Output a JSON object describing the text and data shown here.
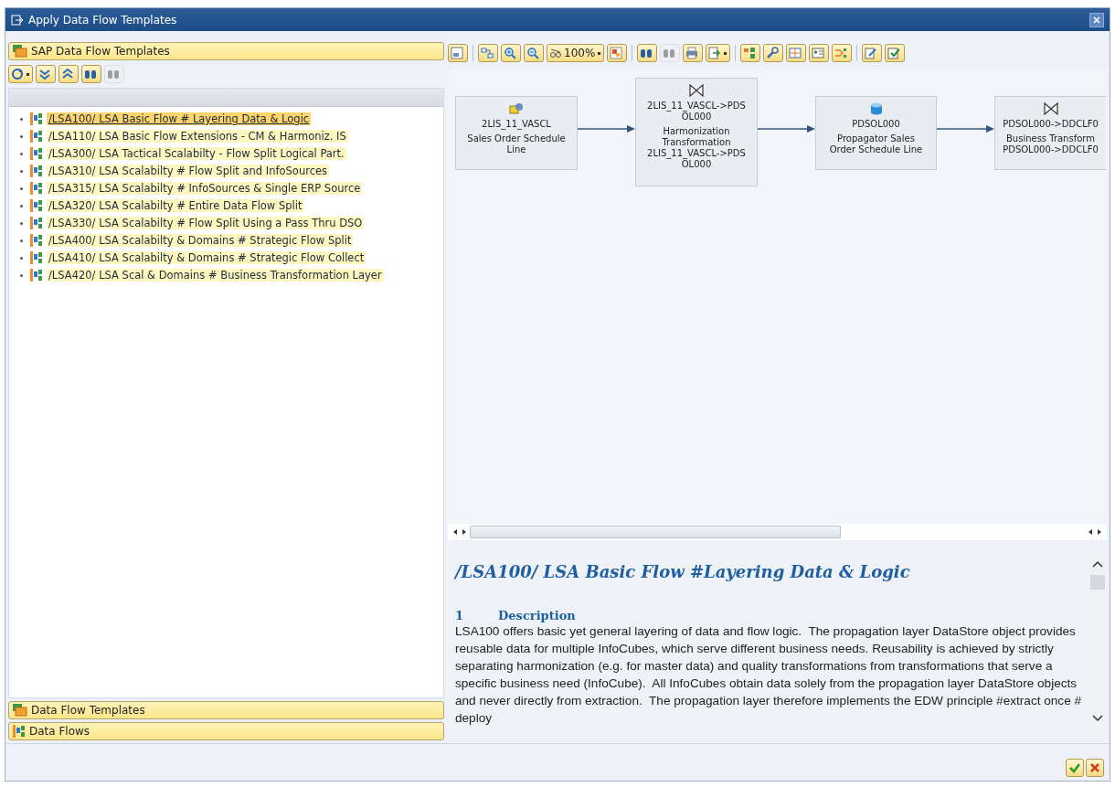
{
  "window": {
    "title": "Apply Data Flow Templates"
  },
  "left_panel": {
    "header": "SAP Data Flow Templates",
    "toolbar": [
      {
        "kind": "refresh",
        "disabled": false
      },
      {
        "kind": "expand",
        "disabled": false
      },
      {
        "kind": "collapse",
        "disabled": false
      },
      {
        "kind": "find",
        "disabled": false
      },
      {
        "kind": "find_next",
        "disabled": true
      }
    ],
    "tree_items": [
      {
        "label": "/LSA100/ LSA Basic Flow # Layering Data & Logic",
        "selected": true
      },
      {
        "label": "/LSA110/ LSA Basic Flow Extensions - CM & Harmoniz. IS",
        "selected": false
      },
      {
        "label": "/LSA300/ LSA Tactical Scalabilty - Flow Split Logical Part.",
        "selected": false
      },
      {
        "label": "/LSA310/ LSA Scalabilty # Flow Split and InfoSources",
        "selected": false
      },
      {
        "label": "/LSA315/ LSA Scalabilty # InfoSources & Single ERP Source",
        "selected": false
      },
      {
        "label": "/LSA320/ LSA Scalabilty # Entire Data Flow Split",
        "selected": false
      },
      {
        "label": "/LSA330/ LSA Scalabilty # Flow Split Using a Pass Thru DSO",
        "selected": false
      },
      {
        "label": "/LSA400/ LSA Scalabilty & Domains # Strategic Flow Split",
        "selected": false
      },
      {
        "label": "/LSA410/ LSA Scalabilty & Domains # Strategic Flow Collect",
        "selected": false
      },
      {
        "label": "/LSA420/ LSA Scal & Domains # Business Transformation Layer",
        "selected": false
      }
    ],
    "sections": [
      {
        "kind": "templates",
        "label": "Data Flow Templates"
      },
      {
        "kind": "flows",
        "label": "Data Flows"
      }
    ]
  },
  "right_panel": {
    "toolbar": [
      {
        "kind": "overview",
        "disabled": false
      },
      {
        "kind": "separator"
      },
      {
        "kind": "layout",
        "disabled": false
      },
      {
        "kind": "zoom_in",
        "disabled": false
      },
      {
        "kind": "zoom_out",
        "disabled": false
      },
      {
        "kind": "zoom",
        "disabled": false,
        "label": "100%"
      },
      {
        "kind": "color",
        "disabled": false
      },
      {
        "kind": "separator"
      },
      {
        "kind": "find",
        "disabled": false
      },
      {
        "kind": "find_next",
        "disabled": true
      },
      {
        "kind": "print",
        "disabled": false
      },
      {
        "kind": "export",
        "disabled": false
      },
      {
        "kind": "separator"
      },
      {
        "kind": "tree",
        "disabled": false
      },
      {
        "kind": "tools",
        "disabled": false
      },
      {
        "kind": "grid",
        "disabled": false
      },
      {
        "kind": "card",
        "disabled": false
      },
      {
        "kind": "branch",
        "disabled": false
      },
      {
        "kind": "separator"
      },
      {
        "kind": "edit",
        "disabled": false
      },
      {
        "kind": "apply",
        "disabled": false
      }
    ],
    "diagram_nodes": [
      {
        "kind": "datasource",
        "name_lines": [
          "2LIS_11_VASCL"
        ],
        "description_lines": [
          "Sales Order Schedule",
          "Line"
        ],
        "clipped": false
      },
      {
        "kind": "transformation",
        "name_lines": [
          "2LIS_11_VASCL->PDS",
          "OL000"
        ],
        "description_lines": [
          "Harmonization",
          "Transformation",
          "2LIS_11_VASCL->PDS",
          "OL000"
        ],
        "clipped": false
      },
      {
        "kind": "datastore",
        "name_lines": [
          "PDSOL000"
        ],
        "description_lines": [
          "Propagator Sales",
          "Order Schedule Line"
        ],
        "clipped": false
      },
      {
        "kind": "transformation",
        "name_lines": [
          "PDSOL000->DDCLF0"
        ],
        "description_lines": [
          "Business Transform",
          "PDSOL000->DDCLF0"
        ],
        "clipped": true
      }
    ],
    "document": {
      "title": "/LSA100/ LSA Basic Flow #Layering Data & Logic",
      "section_number": "1",
      "section_title": "Description",
      "paragraph": "LSA100 offers basic yet general layering of data and flow logic.  The propagation layer DataStore object provides reusable data for multiple InfoCubes, which serve different business needs. Reusability is achieved by strictly separating harmonization (e.g. for master data) and quality transformations from transformations that serve a specific business need (InfoCube).  All InfoCubes obtain data solely from the propagation layer DataStore objects and never directly from extraction.  The propagation layer therefore implements the EDW principle #extract once # deploy"
    }
  }
}
